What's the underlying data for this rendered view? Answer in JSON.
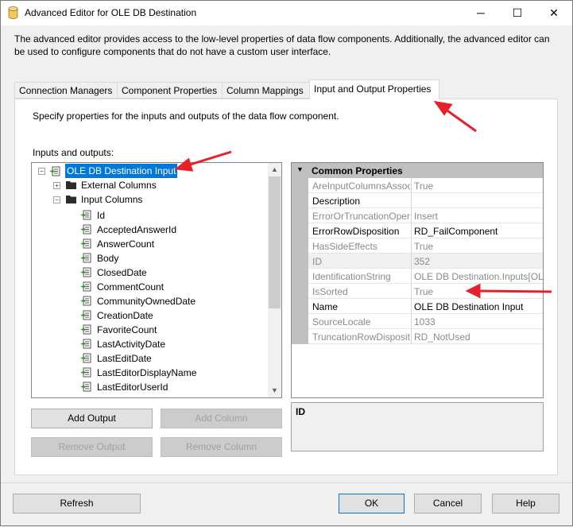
{
  "window": {
    "title": "Advanced Editor for OLE DB Destination",
    "minimize": "─",
    "maximize": "☐",
    "close": "✕"
  },
  "description": "The advanced editor provides access to the low-level properties of data flow components. Additionally, the advanced editor can be used to configure components that do not have a custom user interface.",
  "tabs": [
    {
      "label": "Connection Managers"
    },
    {
      "label": "Component Properties"
    },
    {
      "label": "Column Mappings"
    },
    {
      "label": "Input and Output Properties"
    }
  ],
  "panel": {
    "instruction": "Specify properties for the inputs and outputs of the data flow component.",
    "tree_label": "Inputs and outputs:"
  },
  "tree": {
    "root": "OLE DB Destination Input",
    "external": "External Columns",
    "input": "Input Columns",
    "columns": [
      "Id",
      "AcceptedAnswerId",
      "AnswerCount",
      "Body",
      "ClosedDate",
      "CommentCount",
      "CommunityOwnedDate",
      "CreationDate",
      "FavoriteCount",
      "LastActivityDate",
      "LastEditDate",
      "LastEditorDisplayName",
      "LastEditorUserId"
    ]
  },
  "properties": {
    "category": "Common Properties",
    "rows": [
      {
        "name": "AreInputColumnsAssoc",
        "value": "True",
        "enabled": false
      },
      {
        "name": "Description",
        "value": "",
        "enabled": true
      },
      {
        "name": "ErrorOrTruncationOpera",
        "value": "Insert",
        "enabled": false
      },
      {
        "name": "ErrorRowDisposition",
        "value": "RD_FailComponent",
        "enabled": true
      },
      {
        "name": "HasSideEffects",
        "value": "True",
        "enabled": false
      },
      {
        "name": "ID",
        "value": "352",
        "enabled": false
      },
      {
        "name": "IdentificationString",
        "value": "OLE DB Destination.Inputs[OLE",
        "enabled": false
      },
      {
        "name": "IsSorted",
        "value": "True",
        "enabled": false
      },
      {
        "name": "Name",
        "value": "OLE DB Destination Input",
        "enabled": true
      },
      {
        "name": "SourceLocale",
        "value": "1033",
        "enabled": false
      },
      {
        "name": "TruncationRowDispositi",
        "value": "RD_NotUsed",
        "enabled": false
      }
    ],
    "selected_description_title": "ID"
  },
  "buttons": {
    "add_output": "Add Output",
    "add_column": "Add Column",
    "remove_output": "Remove Output",
    "remove_column": "Remove Column",
    "refresh": "Refresh",
    "ok": "OK",
    "cancel": "Cancel",
    "help": "Help"
  },
  "colors": {
    "selection": "#0078d7",
    "annotation_arrow": "#e8202a"
  }
}
